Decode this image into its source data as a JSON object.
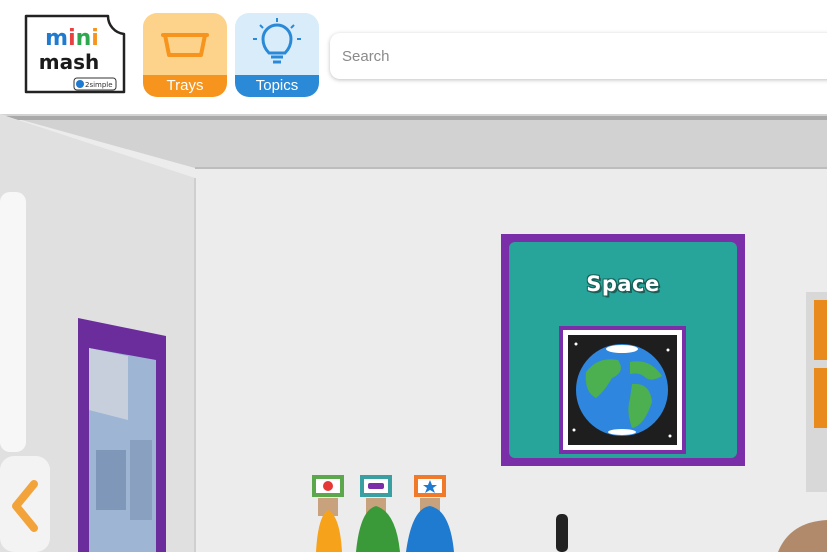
{
  "header": {
    "logo": {
      "line1": "mini",
      "line2": "mash",
      "badge": "2simple"
    },
    "nav": [
      {
        "label": "Trays",
        "icon": "tray-icon",
        "color": "#f7941d"
      },
      {
        "label": "Topics",
        "icon": "lightbulb-icon",
        "color": "#2b8ad8"
      }
    ],
    "search": {
      "placeholder": "Search",
      "value": ""
    }
  },
  "room": {
    "board": {
      "title": "Space",
      "image": "earth-image",
      "background": "#27a59a",
      "border": "#7a2fa8"
    },
    "pegs": [
      {
        "icon": "apple-icon"
      },
      {
        "icon": "car-icon"
      },
      {
        "icon": "star-icon"
      }
    ],
    "navigation": {
      "left_arrow": "chevron-left-icon"
    }
  }
}
